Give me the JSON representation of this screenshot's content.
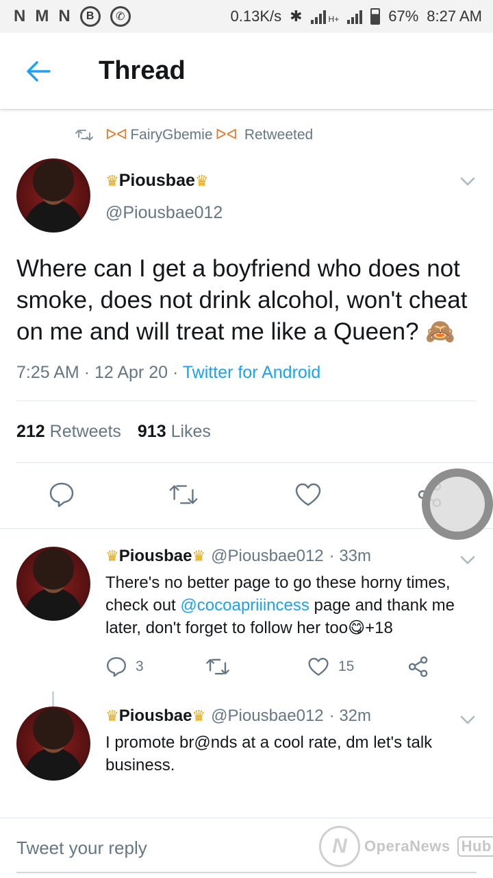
{
  "status_bar": {
    "icons": [
      "N",
      "M",
      "N",
      "B"
    ],
    "speed": "0.13K/s",
    "network": "H+",
    "battery": "67%",
    "time": "8:27 AM"
  },
  "header": {
    "title": "Thread"
  },
  "retweet": {
    "who": "FairyGbemie",
    "label": "Retweeted"
  },
  "main_tweet": {
    "display_name": "Piousbae",
    "handle": "@Piousbae012",
    "text": "Where can I get a boyfriend who does not smoke, does not drink alcohol, won't cheat on me and will treat me like a Queen? 🙈",
    "time": "7:25 AM",
    "date": "12 Apr 20",
    "source": "Twitter for Android",
    "retweets_count": "212",
    "retweets_label": "Retweets",
    "likes_count": "913",
    "likes_label": "Likes"
  },
  "replies": [
    {
      "display_name": "Piousbae",
      "handle": "@Piousbae012",
      "age": "· 33m",
      "text_before": "There's no better page to go these horny times, check out ",
      "mention": "@cocoapriiincess",
      "text_after": " page and thank me later, don't forget to follow her too😋+18",
      "replies_count": "3",
      "likes_count": "15"
    },
    {
      "display_name": "Piousbae",
      "handle": "@Piousbae012",
      "age": "· 32m",
      "text": "I promote br@nds at a cool rate, dm let's talk business."
    }
  ],
  "reply_box": {
    "placeholder": "Tweet your reply"
  },
  "watermark": {
    "brand": "OperaNews",
    "hub": "Hub"
  },
  "colors": {
    "accent": "#1da1f2",
    "muted": "#657786",
    "crown": "#e6a91a"
  }
}
